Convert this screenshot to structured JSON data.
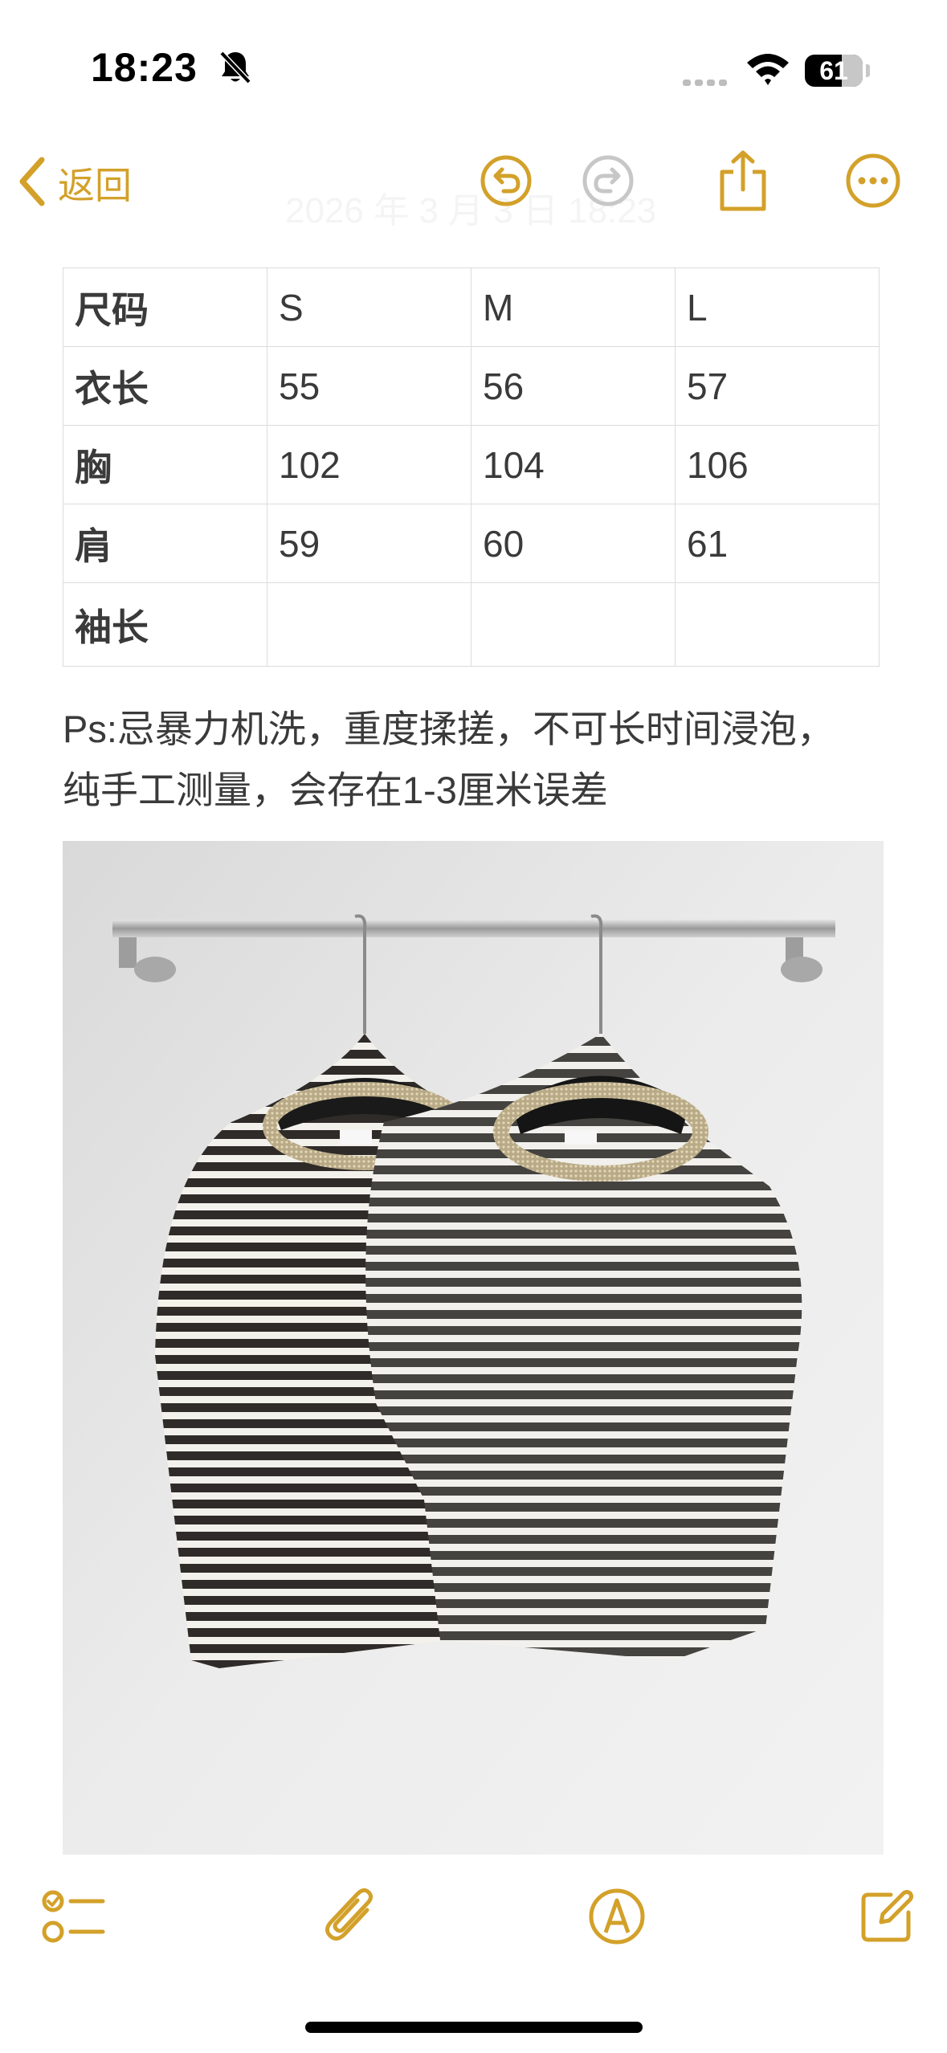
{
  "status_bar": {
    "time": "18:23",
    "battery": "61",
    "battery_fraction": 0.61
  },
  "nav": {
    "back_label": "返回",
    "ghost_date": "2026 年 3 月 3 日 18:23",
    "icons": [
      "chevron-left-icon",
      "undo-icon",
      "redo-icon",
      "share-icon",
      "more-icon"
    ]
  },
  "size_table": {
    "rows": [
      [
        "尺码",
        "S",
        "M",
        "L"
      ],
      [
        "衣长",
        "55",
        "56",
        "57"
      ],
      [
        "胸",
        "102",
        "104",
        "106"
      ],
      [
        "肩",
        "59",
        "60",
        "61"
      ],
      [
        "袖长",
        "",
        "",
        ""
      ]
    ]
  },
  "note": {
    "line1": "Ps:忌暴力机洗，重度揉搓，不可长时间浸泡，",
    "line2": "纯手工测量，会存在1-3厘米误差"
  },
  "toolbar": {
    "icons": [
      "checklist-icon",
      "paperclip-icon",
      "markup-pen-icon",
      "compose-icon"
    ]
  },
  "colors": {
    "accent": "#d3a12a",
    "text": "#3a3a3a",
    "table_border": "#dcdcdc",
    "disabled": "#c7c7c7"
  }
}
